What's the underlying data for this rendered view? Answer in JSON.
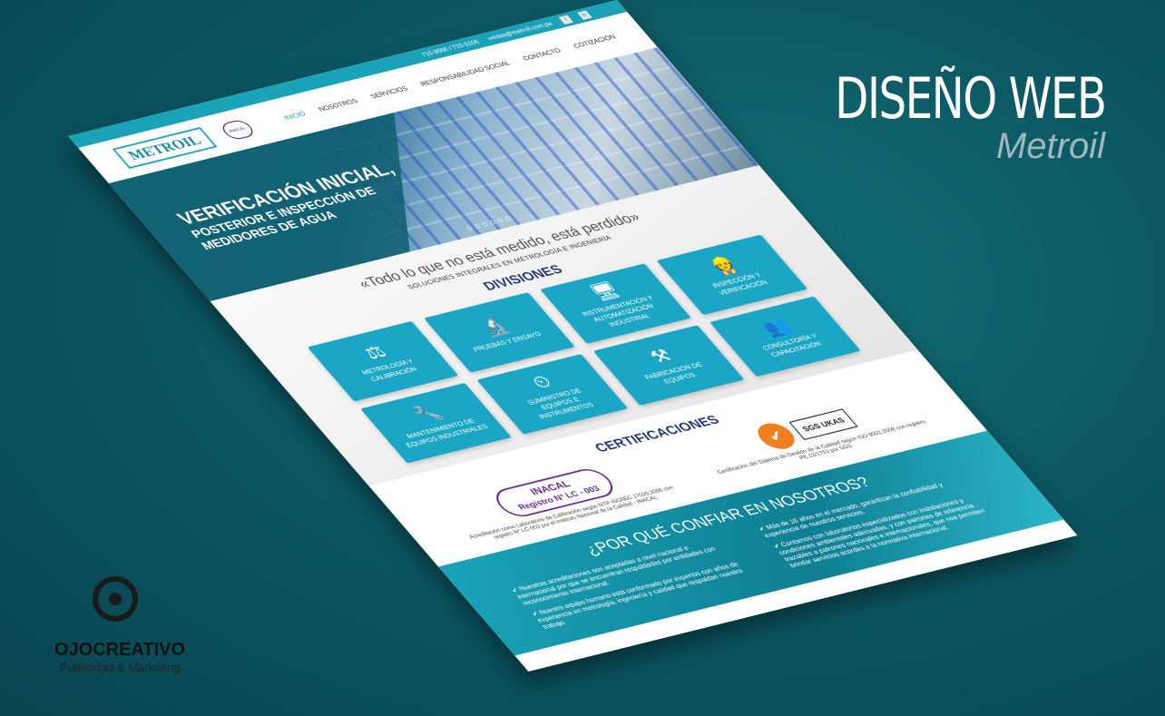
{
  "presentation": {
    "title": "DISEÑO WEB",
    "subtitle": "Metroil"
  },
  "agency": {
    "name": "OJOCREATIVO",
    "tagline": "Publicidad & Marketing"
  },
  "site": {
    "topbar": {
      "phone": "715-9066 / 715-5106",
      "email": "ventas@metroil.com.pe",
      "social": [
        "f",
        "in"
      ]
    },
    "logo": "METROIL",
    "nav": [
      "INICIO",
      "NOSOTROS",
      "SERVICIOS",
      "RESPONSABILIDAD SOCIAL",
      "CONTACTO",
      "COTIZACIÓN"
    ],
    "active_nav": "SERVICIOS",
    "hero": {
      "line1": "VERIFICACIÓN INICIAL,",
      "line2": "POSTERIOR E INSPECCIÓN DE",
      "line3": "MEDIDORES DE AGUA",
      "slides": 6
    },
    "quote": "«Todo lo que no está medido, está perdido»",
    "tagline": "SOLUCIONES INTEGRALES EN METROLOGÍA E INGENIERÍA",
    "divisions_title": "DIVISIONES",
    "divisions": [
      {
        "label": "Metrología y Calibración",
        "icon": "scale-icon"
      },
      {
        "label": "Pruebas y Ensayo",
        "icon": "microscope-icon"
      },
      {
        "label": "Instrumentación y Automatización Industrial",
        "icon": "computer-icon"
      },
      {
        "label": "Inspección y Verificación",
        "icon": "inspector-icon"
      },
      {
        "label": "Mantenimiento de Equipos Industriales",
        "icon": "technician-icon"
      },
      {
        "label": "Suministro de Equipos e Instrumentos",
        "icon": "gauge-icon"
      },
      {
        "label": "Fabricación de Equipos",
        "icon": "welder-icon"
      },
      {
        "label": "Consultoría y Capacitación",
        "icon": "team-icon"
      }
    ],
    "certifications_title": "CERTIFICACIONES",
    "certifications": [
      {
        "logo": "INACAL",
        "registry": "Registro N° LC - 003",
        "text": "Acreditación como Laboratorio de Calibración según NTP-ISO/IEC 17025:2006 con registro N° LC-003 por el Instituto Nacional de la Calidad - INACAL"
      },
      {
        "logo": "SGS UKAS",
        "text": "Certificación del Sistema de Gestión de la Calidad según ISO 9001:2008 con registro PE 13/1753 por SGS"
      }
    ],
    "why": {
      "title": "¿POR QUÉ CONFIAR EN NOSOTROS?",
      "left": [
        "Nuestras acreditaciones son aceptadas a nivel nacional e internacional por que se encuentran respaldadas por entidades con reconocimiento internacional.",
        "Nuestro equipo humano está conformado por expertos con años de experiencia en metrología, ingeniería y calidad que respaldan nuestro trabajo."
      ],
      "right": [
        "Más de 16 años en el mercado, garantizan la confiabilidad y experiencia de nuestros servicios.",
        "Contamos con laboratorios especializados con instalaciones y condiciones ambientales adecuadas, y con patrones de referencia trazables a patrones nacionales e internacionales, que nos permiten brindar servicios acordes a la normativa internacional."
      ]
    }
  }
}
